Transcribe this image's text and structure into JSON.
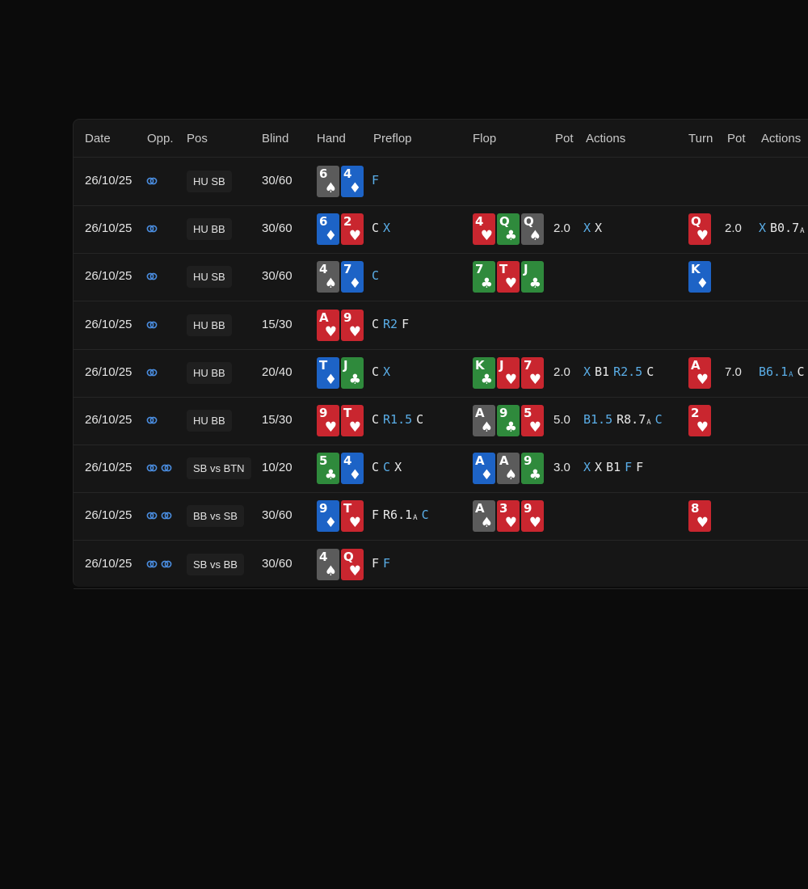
{
  "columns": {
    "date": "Date",
    "opp": "Opp.",
    "pos": "Pos",
    "blind": "Blind",
    "hand": "Hand",
    "preflop": "Preflop",
    "flop": "Flop",
    "pot1": "Pot",
    "actions1": "Actions",
    "turn": "Turn",
    "pot2": "Pot",
    "actions2": "Actions"
  },
  "colors": {
    "background": "#0b0b0b",
    "panel": "#161616",
    "hero_action": "#5aaee8",
    "spade": "#5b5b5b",
    "heart": "#c9262f",
    "diamond": "#1d63c6",
    "club": "#2f8a3c"
  },
  "rows": [
    {
      "date": "26/10/25",
      "opp_icons": 1,
      "pos": "HU SB",
      "blind": "30/60",
      "hand": [
        {
          "rank": "6",
          "suit": "s"
        },
        {
          "rank": "4",
          "suit": "d"
        }
      ],
      "preflop": [
        {
          "t": "F",
          "hero": true
        }
      ],
      "flop": [],
      "flop_pot": "",
      "flop_actions": [],
      "turn": [],
      "turn_pot": "",
      "turn_actions": []
    },
    {
      "date": "26/10/25",
      "opp_icons": 1,
      "pos": "HU BB",
      "blind": "30/60",
      "hand": [
        {
          "rank": "6",
          "suit": "d"
        },
        {
          "rank": "2",
          "suit": "h"
        }
      ],
      "preflop": [
        {
          "t": "C",
          "hero": false
        },
        {
          "t": "X",
          "hero": true
        }
      ],
      "flop": [
        {
          "rank": "4",
          "suit": "h"
        },
        {
          "rank": "Q",
          "suit": "c"
        },
        {
          "rank": "Q",
          "suit": "s"
        }
      ],
      "flop_pot": "2.0",
      "flop_actions": [
        {
          "t": "X",
          "hero": true
        },
        {
          "t": "X",
          "hero": false
        }
      ],
      "turn": [
        {
          "rank": "Q",
          "suit": "h"
        }
      ],
      "turn_pot": "2.0",
      "turn_actions": [
        {
          "t": "X",
          "hero": true
        },
        {
          "t": "B0.7",
          "sub": "A",
          "hero": false
        }
      ]
    },
    {
      "date": "26/10/25",
      "opp_icons": 1,
      "pos": "HU SB",
      "blind": "30/60",
      "hand": [
        {
          "rank": "4",
          "suit": "s"
        },
        {
          "rank": "7",
          "suit": "d"
        }
      ],
      "preflop": [
        {
          "t": "C",
          "hero": true
        }
      ],
      "flop": [
        {
          "rank": "7",
          "suit": "c"
        },
        {
          "rank": "T",
          "suit": "h"
        },
        {
          "rank": "J",
          "suit": "c"
        }
      ],
      "flop_pot": "",
      "flop_actions": [],
      "turn": [
        {
          "rank": "K",
          "suit": "d"
        }
      ],
      "turn_pot": "",
      "turn_actions": []
    },
    {
      "date": "26/10/25",
      "opp_icons": 1,
      "pos": "HU BB",
      "blind": "15/30",
      "hand": [
        {
          "rank": "A",
          "suit": "h"
        },
        {
          "rank": "9",
          "suit": "h"
        }
      ],
      "preflop": [
        {
          "t": "C",
          "hero": false
        },
        {
          "t": "R2",
          "hero": true
        },
        {
          "t": "F",
          "hero": false
        }
      ],
      "flop": [],
      "flop_pot": "",
      "flop_actions": [],
      "turn": [],
      "turn_pot": "",
      "turn_actions": []
    },
    {
      "date": "26/10/25",
      "opp_icons": 1,
      "pos": "HU BB",
      "blind": "20/40",
      "hand": [
        {
          "rank": "T",
          "suit": "d"
        },
        {
          "rank": "J",
          "suit": "c"
        }
      ],
      "preflop": [
        {
          "t": "C",
          "hero": false
        },
        {
          "t": "X",
          "hero": true
        }
      ],
      "flop": [
        {
          "rank": "K",
          "suit": "c"
        },
        {
          "rank": "J",
          "suit": "h"
        },
        {
          "rank": "7",
          "suit": "h"
        }
      ],
      "flop_pot": "2.0",
      "flop_actions": [
        {
          "t": "X",
          "hero": true
        },
        {
          "t": "B1",
          "hero": false
        },
        {
          "t": "R2.5",
          "hero": true
        },
        {
          "t": "C",
          "hero": false
        }
      ],
      "turn": [
        {
          "rank": "A",
          "suit": "h"
        }
      ],
      "turn_pot": "7.0",
      "turn_actions": [
        {
          "t": "B6.1",
          "sub": "A",
          "hero": true
        },
        {
          "t": "C",
          "hero": false
        }
      ]
    },
    {
      "date": "26/10/25",
      "opp_icons": 1,
      "pos": "HU BB",
      "blind": "15/30",
      "hand": [
        {
          "rank": "9",
          "suit": "h"
        },
        {
          "rank": "T",
          "suit": "h"
        }
      ],
      "preflop": [
        {
          "t": "C",
          "hero": false
        },
        {
          "t": "R1.5",
          "hero": true
        },
        {
          "t": "C",
          "hero": false
        }
      ],
      "flop": [
        {
          "rank": "A",
          "suit": "s"
        },
        {
          "rank": "9",
          "suit": "c"
        },
        {
          "rank": "5",
          "suit": "h"
        }
      ],
      "flop_pot": "5.0",
      "flop_actions": [
        {
          "t": "B1.5",
          "hero": true
        },
        {
          "t": "R8.7",
          "sub": "A",
          "hero": false
        },
        {
          "t": "C",
          "hero": true
        }
      ],
      "turn": [
        {
          "rank": "2",
          "suit": "h"
        }
      ],
      "turn_pot": "",
      "turn_actions": []
    },
    {
      "date": "26/10/25",
      "opp_icons": 2,
      "pos": "SB vs BTN",
      "blind": "10/20",
      "hand": [
        {
          "rank": "5",
          "suit": "c"
        },
        {
          "rank": "4",
          "suit": "d"
        }
      ],
      "preflop": [
        {
          "t": "C",
          "hero": false
        },
        {
          "t": "C",
          "hero": true
        },
        {
          "t": "X",
          "hero": false
        }
      ],
      "flop": [
        {
          "rank": "A",
          "suit": "d"
        },
        {
          "rank": "A",
          "suit": "s"
        },
        {
          "rank": "9",
          "suit": "c"
        }
      ],
      "flop_pot": "3.0",
      "flop_actions": [
        {
          "t": "X",
          "hero": true
        },
        {
          "t": "X",
          "hero": false
        },
        {
          "t": "B1",
          "hero": false
        },
        {
          "t": "F",
          "hero": true
        },
        {
          "t": "F",
          "hero": false
        }
      ],
      "turn": [],
      "turn_pot": "",
      "turn_actions": []
    },
    {
      "date": "26/10/25",
      "opp_icons": 2,
      "pos": "BB vs SB",
      "blind": "30/60",
      "hand": [
        {
          "rank": "9",
          "suit": "d"
        },
        {
          "rank": "T",
          "suit": "h"
        }
      ],
      "preflop": [
        {
          "t": "F",
          "hero": false
        },
        {
          "t": "R6.1",
          "sub": "A",
          "hero": false
        },
        {
          "t": "C",
          "hero": true
        }
      ],
      "flop": [
        {
          "rank": "A",
          "suit": "s"
        },
        {
          "rank": "3",
          "suit": "h"
        },
        {
          "rank": "9",
          "suit": "h"
        }
      ],
      "flop_pot": "",
      "flop_actions": [],
      "turn": [
        {
          "rank": "8",
          "suit": "h"
        }
      ],
      "turn_pot": "",
      "turn_actions": []
    },
    {
      "date": "26/10/25",
      "opp_icons": 2,
      "pos": "SB vs BB",
      "blind": "30/60",
      "hand": [
        {
          "rank": "4",
          "suit": "s"
        },
        {
          "rank": "Q",
          "suit": "h"
        }
      ],
      "preflop": [
        {
          "t": "F",
          "hero": false
        },
        {
          "t": "F",
          "hero": true
        }
      ],
      "flop": [],
      "flop_pot": "",
      "flop_actions": [],
      "turn": [],
      "turn_pot": "",
      "turn_actions": []
    }
  ]
}
